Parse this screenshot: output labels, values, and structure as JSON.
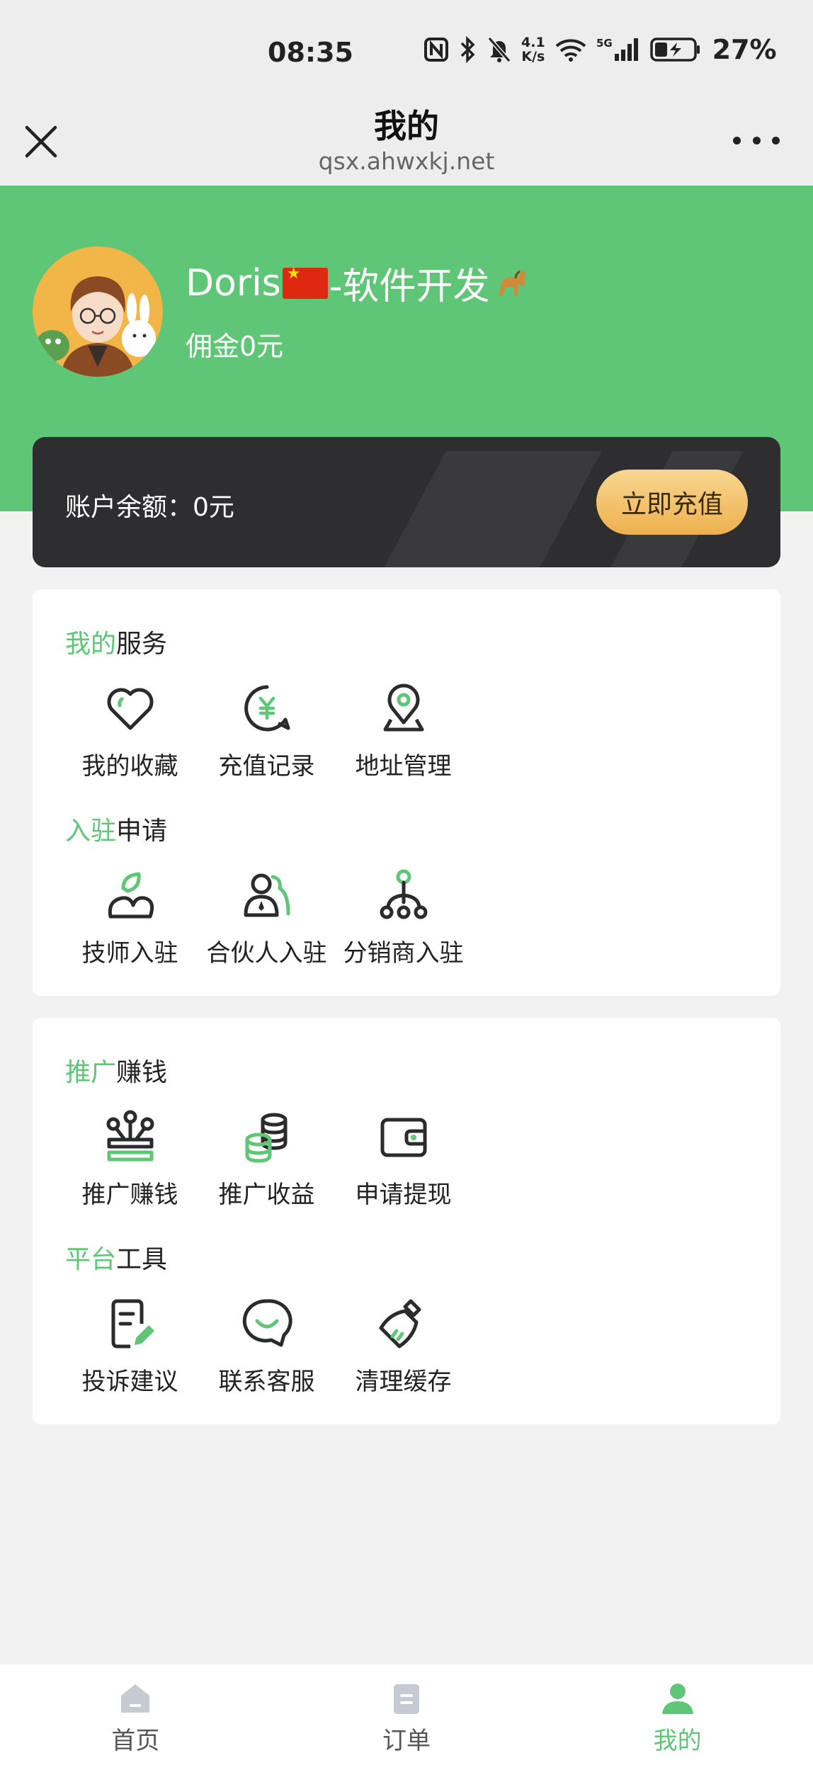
{
  "status_bar": {
    "time": "08:35",
    "network_speed_top": "4.1",
    "network_speed_bottom": "K/s",
    "battery": "27%",
    "icons": [
      "nfc-icon",
      "bluetooth-icon",
      "mute-icon",
      "wifi-icon",
      "5g-signal-icon",
      "battery-icon"
    ]
  },
  "header": {
    "title": "我的",
    "url": "qsx.ahwxkj.net",
    "close_icon": "close-icon",
    "more_icon": "more-icon"
  },
  "profile": {
    "name_prefix": "Doris",
    "name_suffix": "-软件开发",
    "commission": "佣金0元",
    "colors": {
      "banner": "#5ec676"
    }
  },
  "balance": {
    "label": "账户余额：0元",
    "button": "立即充值"
  },
  "sections": {
    "my_services": {
      "title_hl": "我的",
      "title_rest": "服务",
      "items": [
        {
          "label": "我的收藏",
          "icon": "heart-icon"
        },
        {
          "label": "充值记录",
          "icon": "yuan-bubble-icon"
        },
        {
          "label": "地址管理",
          "icon": "location-pin-icon"
        }
      ]
    },
    "join": {
      "title_hl": "入驻",
      "title_rest": "申请",
      "items": [
        {
          "label": "技师入驻",
          "icon": "technician-icon"
        },
        {
          "label": "合伙人入驻",
          "icon": "partner-icon"
        },
        {
          "label": "分销商入驻",
          "icon": "distributor-icon"
        }
      ]
    },
    "promote": {
      "title_hl": "推广",
      "title_rest": "赚钱",
      "items": [
        {
          "label": "推广赚钱",
          "icon": "promote-icon"
        },
        {
          "label": "推广收益",
          "icon": "coins-icon"
        },
        {
          "label": "申请提现",
          "icon": "wallet-icon"
        }
      ]
    },
    "tools": {
      "title_hl": "平台",
      "title_rest": "工具",
      "items": [
        {
          "label": "投诉建议",
          "icon": "feedback-doc-icon"
        },
        {
          "label": "联系客服",
          "icon": "service-chat-icon"
        },
        {
          "label": "清理缓存",
          "icon": "broom-icon"
        }
      ]
    }
  },
  "tabbar": {
    "tabs": [
      {
        "label": "首页",
        "icon": "home-icon",
        "active": false
      },
      {
        "label": "订单",
        "icon": "order-icon",
        "active": false
      },
      {
        "label": "我的",
        "icon": "user-icon",
        "active": true
      }
    ],
    "active_color": "#5ec676"
  }
}
